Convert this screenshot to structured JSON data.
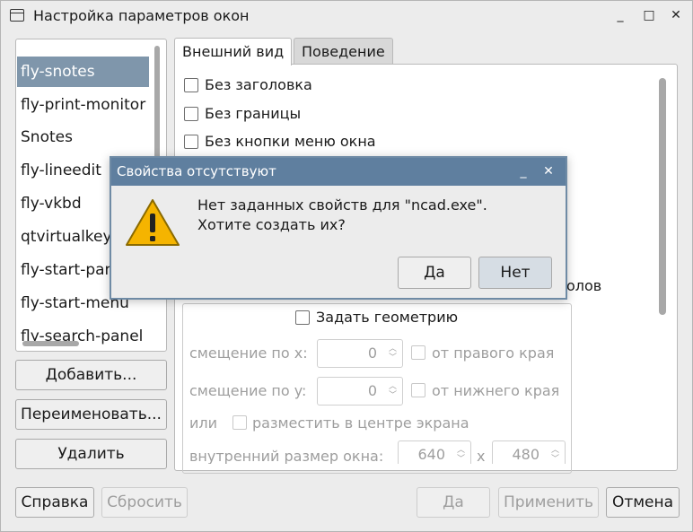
{
  "window": {
    "title": "Настройка параметров окон",
    "controls": {
      "minimize": "_",
      "maximize": "□",
      "close": "✕"
    }
  },
  "class_list": {
    "items": [
      "fly-snotes",
      "fly-print-monitor",
      "Snotes",
      "fly-lineedit",
      "fly-vkbd",
      "qtvirtualkeyboard",
      "fly-start-panel",
      "fly-start-menu",
      "fly-search-panel"
    ],
    "selected_index": 0
  },
  "left_buttons": {
    "add": "Добавить...",
    "rename": "Переименовать...",
    "delete": "Удалить"
  },
  "tabs": [
    {
      "label": "Внешний вид",
      "active": true
    },
    {
      "label": "Поведение",
      "active": false
    }
  ],
  "appearance": {
    "no_title": "Без заголовка",
    "no_border": "Без границы",
    "no_menu_button": "Без кнопки меню окна",
    "partial_label_tail": "олов",
    "set_geometry": "Задать геометрию",
    "offset_x_label": "смещение по x:",
    "offset_x_value": "0",
    "from_right": "от правого края",
    "offset_y_label": "смещение по y:",
    "offset_y_value": "0",
    "from_bottom": "от нижнего края",
    "or_label": "или",
    "center_screen": "разместить в центре экрана",
    "inner_size_label": "внутренний размер окна:",
    "width_value": "640",
    "x_sep": "x",
    "height_value": "480"
  },
  "bottom_buttons": {
    "help": "Справка",
    "reset": "Сбросить",
    "ok": "Да",
    "apply": "Применить",
    "cancel": "Отмена"
  },
  "dialog": {
    "title": "Свойства отсутствуют",
    "message": "Нет заданных свойств для \"ncad.exe\".\nХотите создать их?",
    "yes": "Да",
    "no": "Нет",
    "icon": "warning-icon"
  },
  "colors": {
    "selection": "#7f96ab",
    "dialog_titlebar": "#5f7f9f",
    "warning_yellow": "#f5b400"
  }
}
